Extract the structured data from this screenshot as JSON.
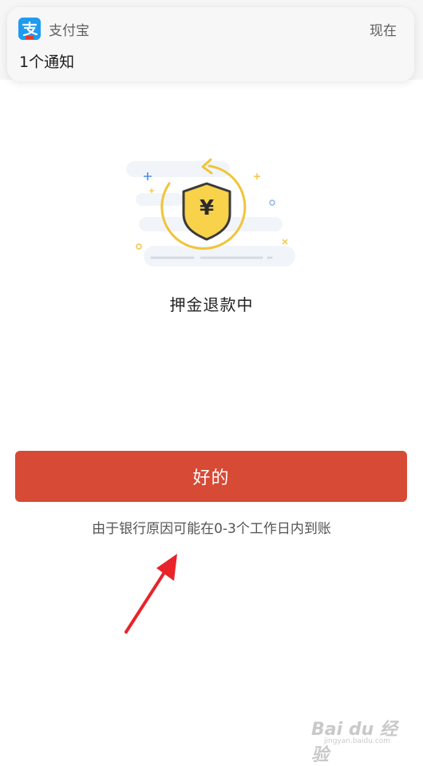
{
  "notification": {
    "app_name": "支付宝",
    "time": "现在",
    "message": "1个通知"
  },
  "status": {
    "title": "押金退款中",
    "currency_symbol": "¥"
  },
  "actions": {
    "ok_label": "好的"
  },
  "notice_text": "由于银行原因可能在0-3个工作日内到账",
  "watermark": {
    "brand": "Bai du 经验",
    "url": "jingyan.baidu.com"
  },
  "colors": {
    "primary_button": "#d74a35",
    "shield_fill": "#f7d24a",
    "accent_yellow": "#f2c43a",
    "alipay_blue": "#1f9bf0"
  }
}
